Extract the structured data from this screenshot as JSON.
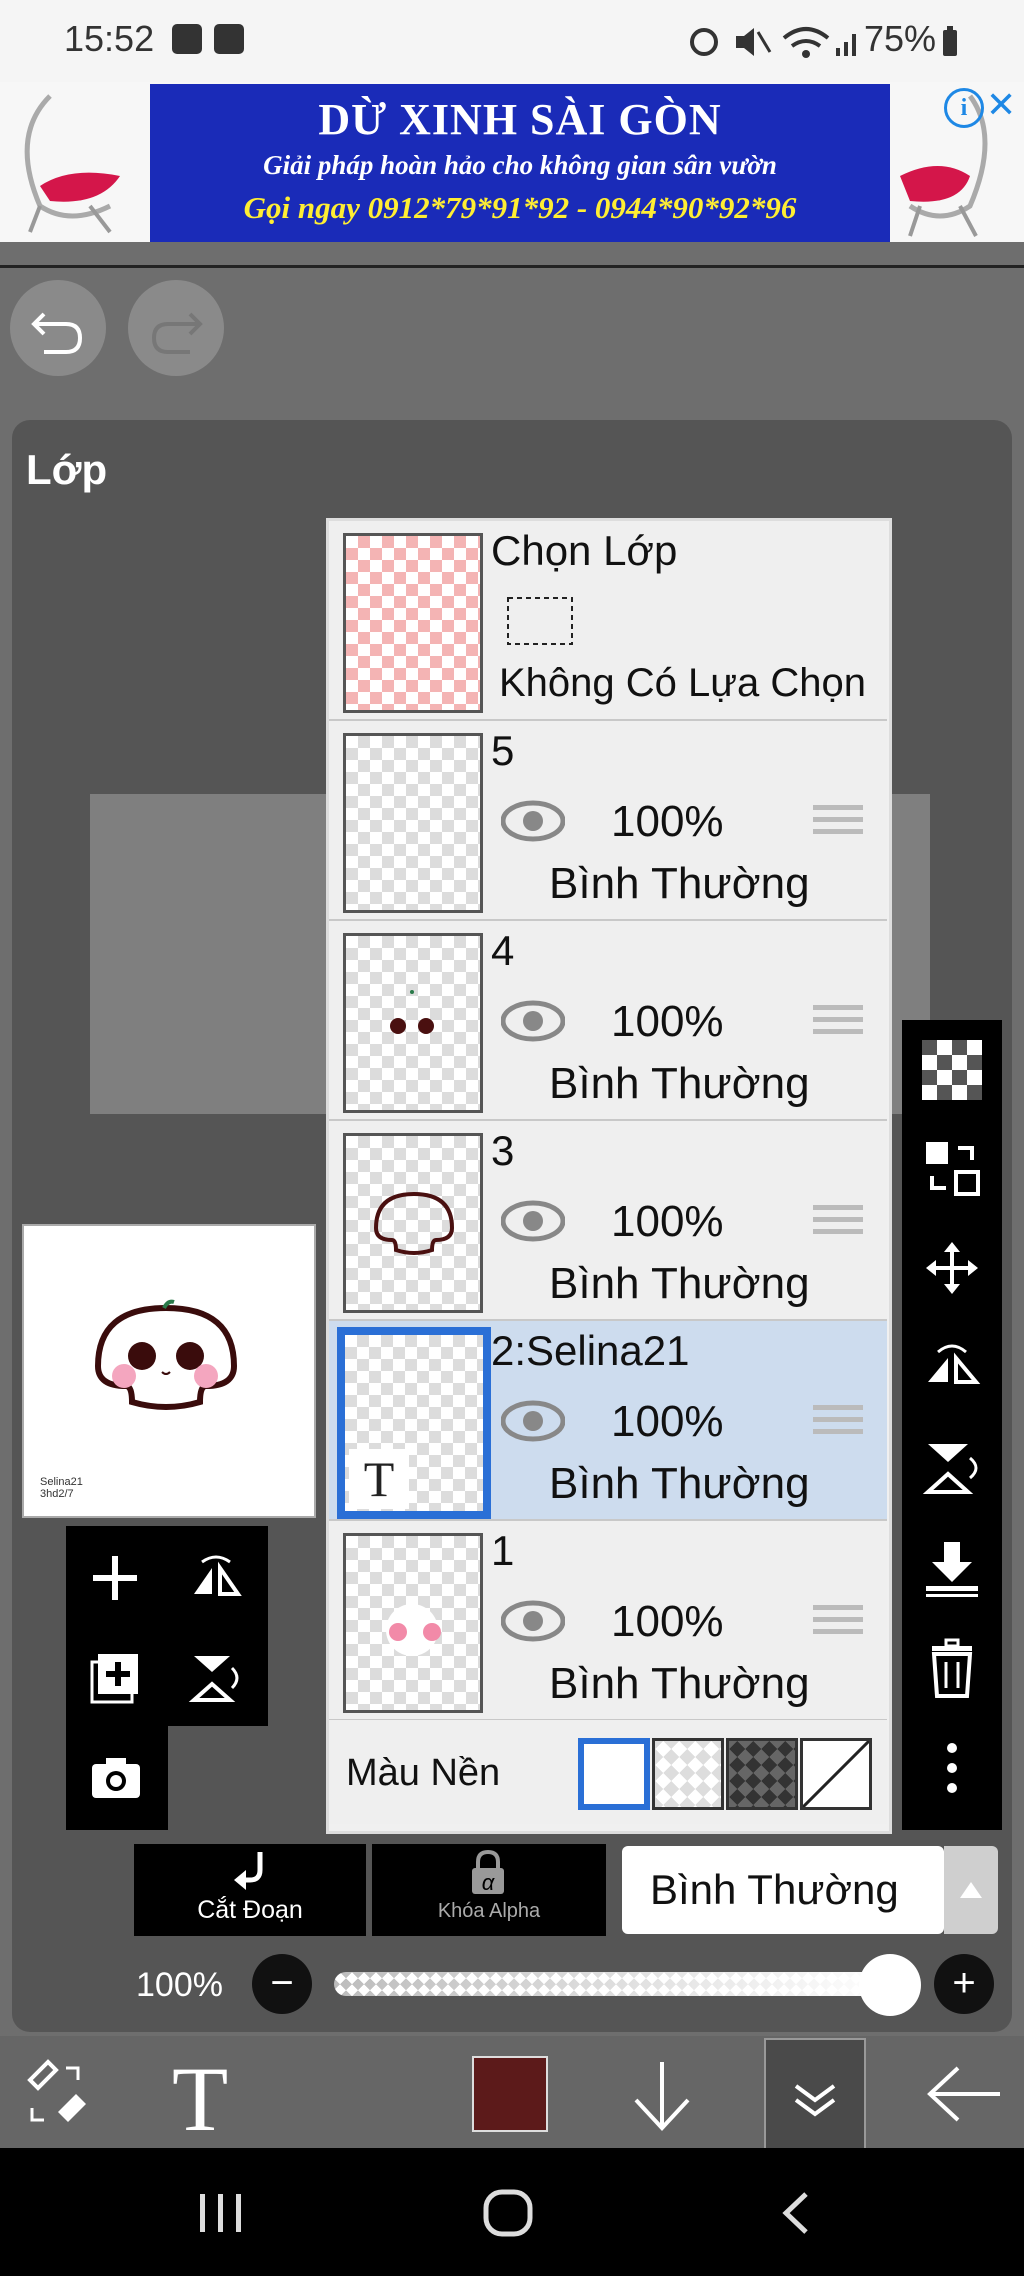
{
  "status_bar": {
    "time": "15:52",
    "battery": "75%"
  },
  "ad": {
    "title": "DỪ XINH SÀI GÒN",
    "subtitle": "Giải pháp hoàn hảo cho không gian sân vườn",
    "phone": "Gọi ngay 0912*79*91*92 - 0944*90*92*96",
    "info_icon": "i",
    "close_icon": "✕"
  },
  "panel": {
    "title": "Lớp"
  },
  "selection_layer": {
    "name": "Chọn Lớp",
    "status": "Không Có Lựa Chọn"
  },
  "layers": [
    {
      "name": "5",
      "opacity": "100%",
      "blend": "Bình Thường"
    },
    {
      "name": "4",
      "opacity": "100%",
      "blend": "Bình Thường"
    },
    {
      "name": "3",
      "opacity": "100%",
      "blend": "Bình Thường"
    },
    {
      "name": "2:Selina21",
      "opacity": "100%",
      "blend": "Bình Thường",
      "selected": true,
      "text_badge": "T"
    },
    {
      "name": "1",
      "opacity": "100%",
      "blend": "Bình Thường"
    }
  ],
  "background": {
    "label": "Màu Nền"
  },
  "mini_preview": {
    "text_line1": "Selina21",
    "text_line2": "3hd2/7"
  },
  "controls": {
    "cut_label": "Cắt Đoạn",
    "alpha_label": "Khóa Alpha",
    "alpha_symbol": "α",
    "blend_mode": "Bình Thường",
    "opacity_label": "100%",
    "opacity_value": 1.0,
    "minus": "−",
    "plus": "+"
  },
  "toolbar": {
    "text_tool": "T",
    "current_color": "#5c1a1a"
  }
}
